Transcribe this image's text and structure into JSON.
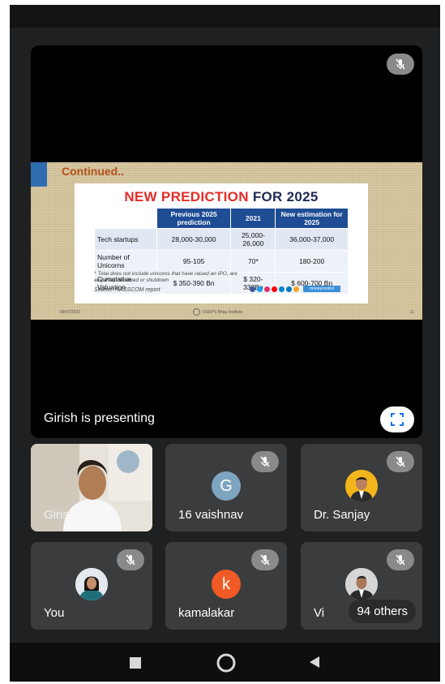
{
  "presentation": {
    "presenter_caption": "Girish is presenting",
    "slide": {
      "continued": "Continued..",
      "title_red": "NEW PREDICTION",
      "title_dark": "FOR 2025",
      "headers": [
        "",
        "Previous 2025 prediction",
        "2021",
        "New estimation for 2025"
      ],
      "rows": [
        [
          "Tech startups",
          "28,000-30,000",
          "25,000-26,000",
          "36,000-37,000"
        ],
        [
          "Number of Unicorns",
          "95-105",
          "70*",
          "180-200"
        ],
        [
          "Cumulative Valuation",
          "$ 350-390 Bn",
          "$ 320-330Bn",
          "$ 600-700 Bn"
        ]
      ],
      "footnote": "* Total does not include unicorns that have raised an IPO, are acquired, devalued or shutdown",
      "source": "Source: NASSCOM report",
      "brand_tag": "moneycontrol",
      "date": "09/07/2022",
      "institute": "OSEP's Bhau Institute",
      "page_number": "11"
    }
  },
  "participants": {
    "tile1": {
      "name": "Girish"
    },
    "tile2": {
      "name": "16 vaishnav",
      "initial": "G",
      "color": "#7ea5c0"
    },
    "tile3": {
      "name": "Dr. Sanjay"
    },
    "tile4": {
      "name": "You"
    },
    "tile5": {
      "name": "kamalakar",
      "initial": "k",
      "color": "#f15a24"
    },
    "tile6": {
      "name": "Vi",
      "others_label": "94 others"
    }
  },
  "icons": {
    "muted": "mic-off-icon",
    "fullscreen": "fullscreen-icon",
    "nav_recent": "square-icon",
    "nav_home": "circle-icon",
    "nav_back": "triangle-back-icon"
  }
}
